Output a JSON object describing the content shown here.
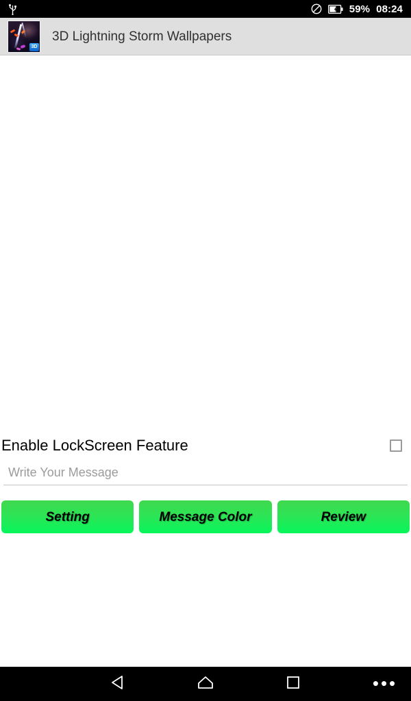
{
  "status_bar": {
    "usb_icon": "usb-icon",
    "mute_icon": "no-entry-icon",
    "battery_icon": "battery-charging-icon",
    "battery_percent": "59%",
    "clock": "08:24"
  },
  "app_bar": {
    "thumbnail_icon": "app-thumbnail-lightning",
    "thumbnail_badge": "3D",
    "title": "3D Lightning Storm Wallpapers"
  },
  "main": {
    "enable_lockscreen_label": "Enable LockScreen Feature",
    "enable_lockscreen_checked": false,
    "message_input": {
      "value": "",
      "placeholder": "Write Your Message"
    },
    "buttons": [
      {
        "label": "Setting",
        "name": "setting-button"
      },
      {
        "label": "Message Color",
        "name": "message-color-button"
      },
      {
        "label": "Review",
        "name": "review-button"
      }
    ],
    "accent_color": "#07f65c"
  },
  "nav_bar": {
    "back_icon": "back-triangle-icon",
    "home_icon": "home-icon",
    "recents_icon": "recents-square-icon",
    "more_icon": "overflow-dots-icon",
    "more_label": "•••"
  }
}
